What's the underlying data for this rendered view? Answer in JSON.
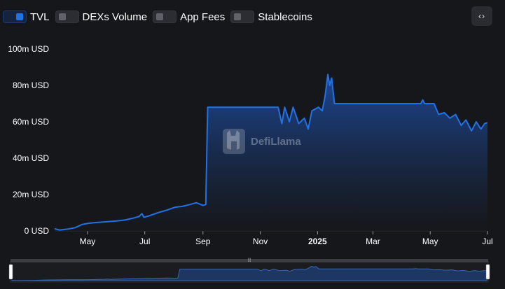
{
  "toggles": [
    {
      "label": "TVL",
      "active": true
    },
    {
      "label": "DEXs Volume",
      "active": false
    },
    {
      "label": "App Fees",
      "active": false
    },
    {
      "label": "Stablecoins",
      "active": false
    }
  ],
  "embed_button": {
    "label": "‹›",
    "icon": "code-icon"
  },
  "watermark": {
    "text": "DefiLlama",
    "icon": "llama-logo-icon"
  },
  "colors": {
    "line": "#2172e5",
    "background": "#16171b",
    "fill_top": "#1d4a9a",
    "fill_bottom": "#16171b"
  },
  "chart_data": {
    "type": "area",
    "series": [
      {
        "name": "TVL",
        "unit": "USD",
        "points": [
          [
            "2024-03-27",
            1.2
          ],
          [
            "2024-04-01",
            0.5
          ],
          [
            "2024-04-10",
            1.0
          ],
          [
            "2024-04-18",
            1.8
          ],
          [
            "2024-04-25",
            3.5
          ],
          [
            "2024-05-02",
            4.2
          ],
          [
            "2024-05-10",
            4.6
          ],
          [
            "2024-05-20",
            5.0
          ],
          [
            "2024-06-01",
            5.5
          ],
          [
            "2024-06-10",
            6.0
          ],
          [
            "2024-06-20",
            7.2
          ],
          [
            "2024-06-25",
            8.0
          ],
          [
            "2024-06-28",
            9.5
          ],
          [
            "2024-06-30",
            7.5
          ],
          [
            "2024-07-05",
            8.2
          ],
          [
            "2024-07-15",
            10.0
          ],
          [
            "2024-07-25",
            11.5
          ],
          [
            "2024-08-02",
            13.0
          ],
          [
            "2024-08-10",
            13.5
          ],
          [
            "2024-08-18",
            14.5
          ],
          [
            "2024-08-25",
            15.5
          ],
          [
            "2024-09-01",
            14.0
          ],
          [
            "2024-09-04",
            14.5
          ],
          [
            "2024-09-06",
            68.0
          ],
          [
            "2024-11-20",
            68.0
          ],
          [
            "2024-11-24",
            59.0
          ],
          [
            "2024-11-27",
            68.0
          ],
          [
            "2024-12-02",
            60.0
          ],
          [
            "2024-12-06",
            68.0
          ],
          [
            "2024-12-12",
            59.0
          ],
          [
            "2024-12-18",
            62.0
          ],
          [
            "2024-12-22",
            56.0
          ],
          [
            "2024-12-26",
            66.0
          ],
          [
            "2025-01-02",
            68.0
          ],
          [
            "2025-01-06",
            66.0
          ],
          [
            "2025-01-09",
            74.0
          ],
          [
            "2025-01-12",
            86.0
          ],
          [
            "2025-01-14",
            80.0
          ],
          [
            "2025-01-16",
            84.0
          ],
          [
            "2025-01-19",
            70.0
          ],
          [
            "2025-01-21",
            70.0
          ],
          [
            "2025-04-21",
            70.0
          ],
          [
            "2025-04-23",
            72.0
          ],
          [
            "2025-04-25",
            70.0
          ],
          [
            "2025-05-05",
            70.0
          ],
          [
            "2025-05-10",
            64.0
          ],
          [
            "2025-05-16",
            65.0
          ],
          [
            "2025-05-22",
            62.0
          ],
          [
            "2025-05-28",
            64.0
          ],
          [
            "2025-06-03",
            58.0
          ],
          [
            "2025-06-08",
            61.0
          ],
          [
            "2025-06-14",
            55.0
          ],
          [
            "2025-06-19",
            60.0
          ],
          [
            "2025-06-24",
            56.0
          ],
          [
            "2025-06-28",
            59.0
          ],
          [
            "2025-07-01",
            59.5
          ]
        ]
      }
    ],
    "x_ticks": [
      {
        "label": "May",
        "date": "2024-05-01",
        "bold": false
      },
      {
        "label": "Jul",
        "date": "2024-07-01",
        "bold": false
      },
      {
        "label": "Sep",
        "date": "2024-09-01",
        "bold": false
      },
      {
        "label": "Nov",
        "date": "2024-11-01",
        "bold": false
      },
      {
        "label": "2025",
        "date": "2025-01-01",
        "bold": true
      },
      {
        "label": "Mar",
        "date": "2025-03-01",
        "bold": false
      },
      {
        "label": "May",
        "date": "2025-05-01",
        "bold": false
      },
      {
        "label": "Jul",
        "date": "2025-07-01",
        "bold": false
      }
    ],
    "y_ticks": [
      {
        "label": "0 USD",
        "value": 0
      },
      {
        "label": "20m USD",
        "value": 20
      },
      {
        "label": "40m USD",
        "value": 40
      },
      {
        "label": "60m USD",
        "value": 60
      },
      {
        "label": "80m USD",
        "value": 80
      },
      {
        "label": "100m USD",
        "value": 100
      }
    ],
    "ylim": [
      0,
      100
    ],
    "xlim": [
      "2024-03-27",
      "2025-07-01"
    ],
    "grid": false,
    "brush": {
      "range": "full"
    }
  }
}
